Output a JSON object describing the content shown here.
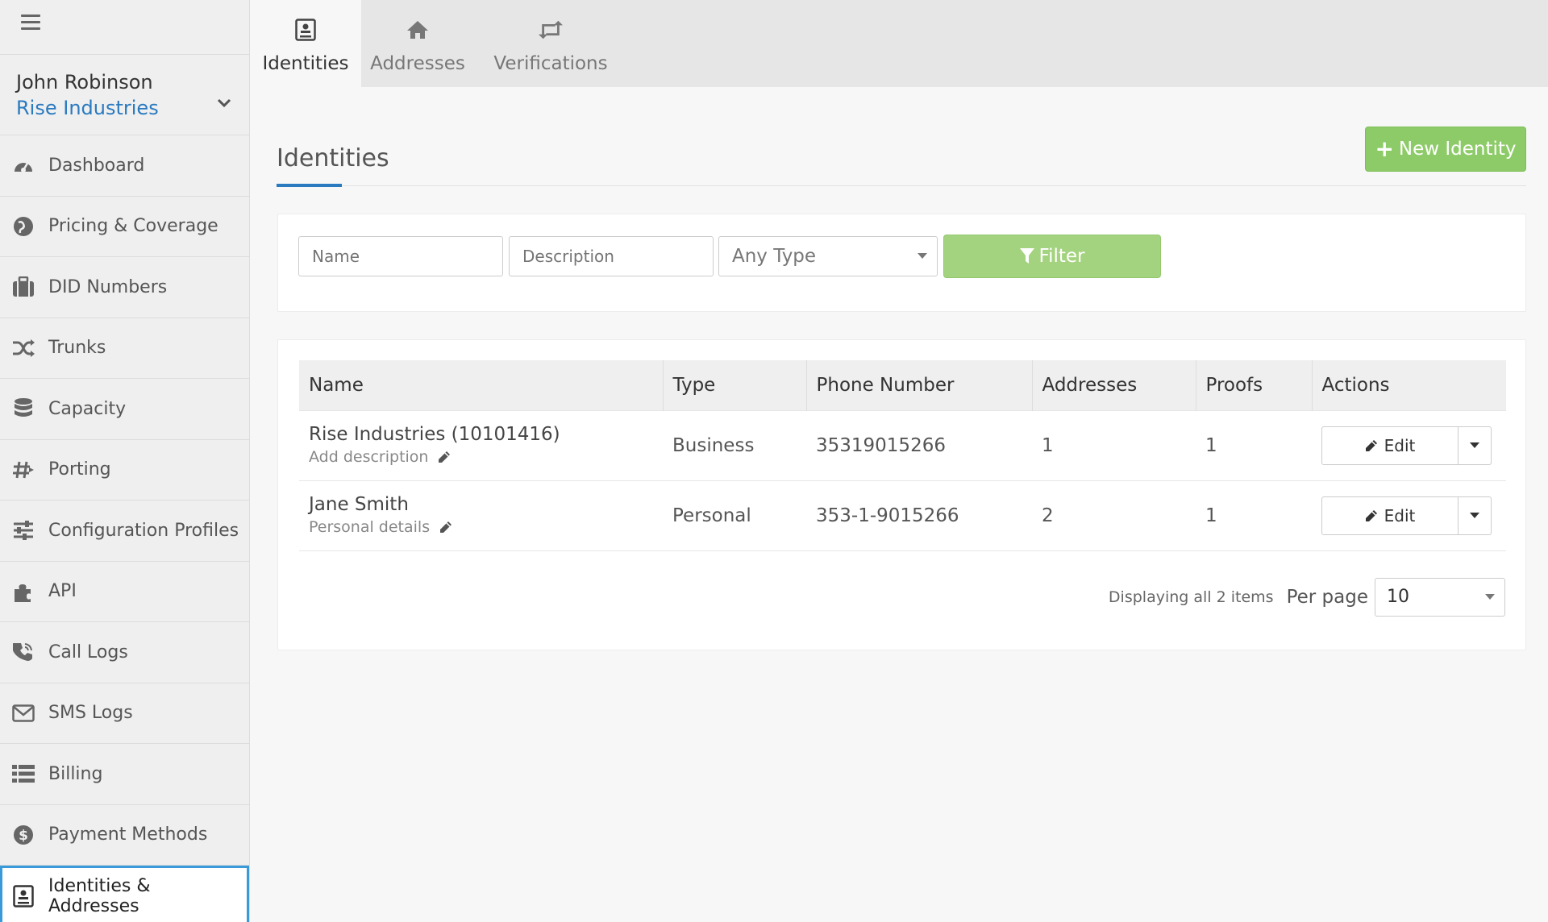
{
  "sidebar": {
    "user_name": "John Robinson",
    "org_name": "Rise Industries",
    "items": [
      {
        "label": "Dashboard",
        "icon": "dashboard-icon"
      },
      {
        "label": "Pricing & Coverage",
        "icon": "globe-icon"
      },
      {
        "label": "DID Numbers",
        "icon": "briefcase-icon"
      },
      {
        "label": "Trunks",
        "icon": "shuffle-icon"
      },
      {
        "label": "Capacity",
        "icon": "database-icon"
      },
      {
        "label": "Porting",
        "icon": "hashtag-icon"
      },
      {
        "label": "Configuration Profiles",
        "icon": "sliders-icon"
      },
      {
        "label": "API",
        "icon": "puzzle-icon"
      },
      {
        "label": "Call Logs",
        "icon": "phone-icon"
      },
      {
        "label": "SMS Logs",
        "icon": "envelope-icon"
      },
      {
        "label": "Billing",
        "icon": "list-icon"
      },
      {
        "label": "Payment Methods",
        "icon": "dollar-icon"
      },
      {
        "label": "Identities & Addresses",
        "icon": "id-card-icon",
        "active": true
      }
    ]
  },
  "tabs": [
    {
      "label": "Identities",
      "icon": "id-card-icon",
      "active": true
    },
    {
      "label": "Addresses",
      "icon": "home-icon"
    },
    {
      "label": "Verifications",
      "icon": "retweet-icon"
    }
  ],
  "page": {
    "title": "Identities",
    "new_button": "New Identity"
  },
  "filter": {
    "name_placeholder": "Name",
    "description_placeholder": "Description",
    "type_value": "Any Type",
    "button": "Filter"
  },
  "table": {
    "headers": [
      "Name",
      "Type",
      "Phone Number",
      "Addresses",
      "Proofs",
      "Actions"
    ],
    "rows": [
      {
        "name": "Rise Industries (10101416)",
        "description": "Add description",
        "type": "Business",
        "phone": "35319015266",
        "addresses": "1",
        "proofs": "1",
        "action": "Edit"
      },
      {
        "name": "Jane Smith",
        "description": "Personal details",
        "type": "Personal",
        "phone": "353-1-9015266",
        "addresses": "2",
        "proofs": "1",
        "action": "Edit"
      }
    ]
  },
  "pagination": {
    "info": "Displaying all 2 items",
    "per_page_label": "Per page",
    "per_page_value": "10"
  },
  "colors": {
    "accent_blue": "#2a7ac0",
    "active_border": "#3a9ad9",
    "primary_green": "#8dcb68",
    "filter_green": "#a4d37f"
  }
}
